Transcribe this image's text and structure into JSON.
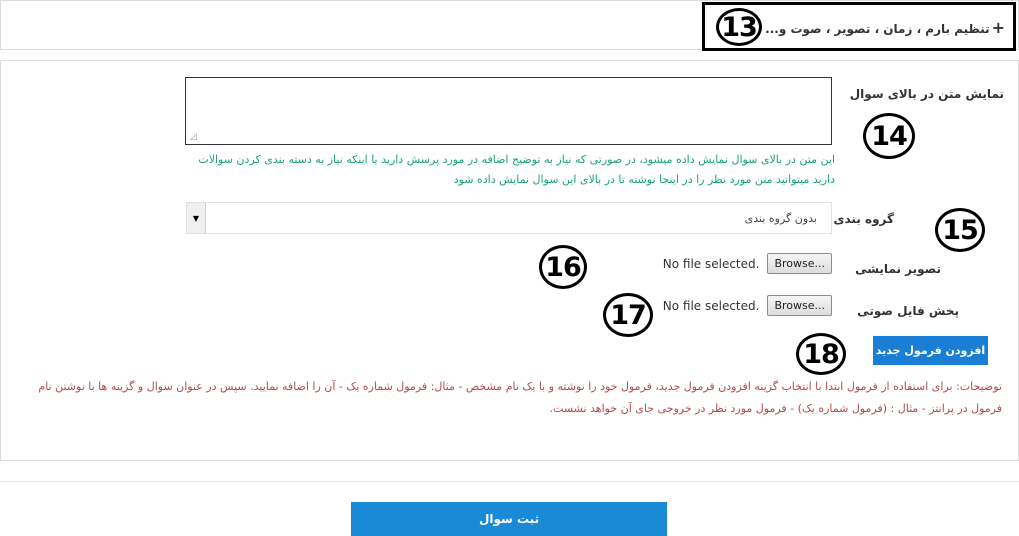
{
  "header": {
    "title": "تنظیم بارم ، زمان ، تصویر ، صوت و...",
    "plus_icon": "+",
    "annotation": "13"
  },
  "text_above": {
    "label": "نمایش متن در بالای سوال",
    "annotation": "14",
    "value": "",
    "help": "این متن در بالای سوال نمایش داده میشود، در صورتی که نیاز به توضیح اضافه در مورد پرسش دارید یا اینکه نیاز به دسته بندی کردن سوالات دارید میتوانید متن مورد نظر را در اینجا نوشته تا در بالای این سوال نمایش داده شود"
  },
  "grouping": {
    "label": "گروه بندی",
    "annotation": "15",
    "selected": "بدون گروه بندی"
  },
  "image": {
    "label": "تصویر نمایشی",
    "annotation": "16",
    "browse_label": "Browse...",
    "status": "No file selected."
  },
  "audio": {
    "label": "پخش فایل صوتی",
    "annotation": "17",
    "browse_label": "Browse...",
    "status": "No file selected."
  },
  "formula": {
    "add_label": "افزودن فرمول جدید",
    "annotation": "18",
    "note": "توضیحات: برای استفاده از فرمول ابتدا با انتخاب گزینه افزودن فرمول جدید، فرمول خود را نوشته و با یک نام مشخص - مثال: فرمول شماره یک - آن را اضافه نمایید. سپس در عنوان سوال و گزینه ها با نوشتن نام فرمول در پرانتز - مثال : (فرمول شماره یک) - فرمول مورد نظر در خروجی جای آن خواهد نشست."
  },
  "submit": {
    "label": "ثبت سوال"
  },
  "colors": {
    "primary": "#1a8ad6",
    "help_text": "#1aa37a",
    "note_text": "#b24a4a"
  }
}
